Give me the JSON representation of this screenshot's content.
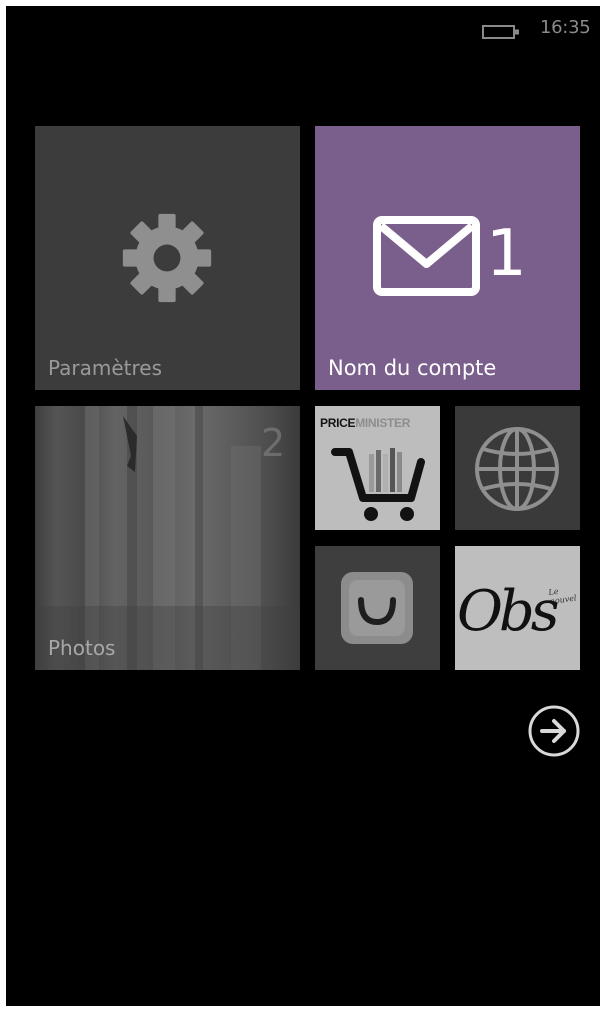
{
  "status_bar": {
    "time": "16:35",
    "battery_icon": "battery-icon"
  },
  "tiles": {
    "settings": {
      "label": "Paramètres",
      "icon": "gear-icon"
    },
    "mail": {
      "label": "Nom du compte",
      "count": "1",
      "icon": "envelope-icon",
      "accent": "#7a5f8c"
    },
    "photos": {
      "label": "Photos"
    },
    "priceminister": {
      "logo_part1": "PRICE",
      "logo_part2": "MINISTER",
      "icon": "cart-icon"
    },
    "browser": {
      "icon": "globe-icon"
    },
    "smile": {
      "icon": "smile-icon"
    },
    "obs": {
      "logo_small": "Le nouvel",
      "logo": "Obs"
    }
  },
  "navigation": {
    "next_icon": "arrow-right-circle-icon"
  }
}
